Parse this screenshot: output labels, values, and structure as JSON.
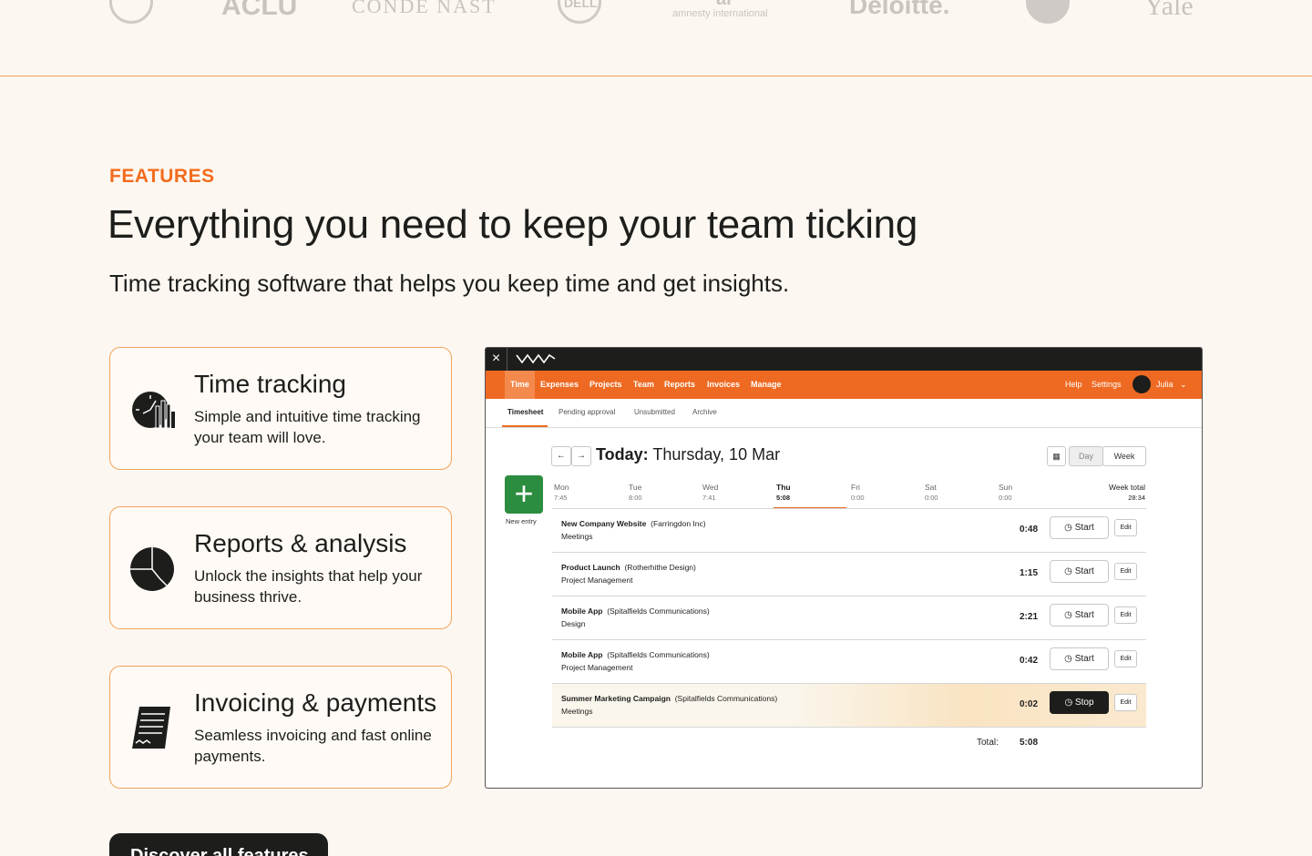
{
  "logos": {
    "aclu": "ACLU",
    "conde": "CONDÉ NAST",
    "dell": "DELL",
    "amnesty_mark": "ai",
    "amnesty": "amnesty international",
    "deloitte": "Deloitte.",
    "yale": "Yale"
  },
  "features": {
    "eyebrow": "FEATURES",
    "title": "Everything you need to keep your team ticking",
    "subtitle": "Time tracking software that helps you keep time and get insights.",
    "cards": [
      {
        "title": "Time tracking",
        "desc": "Simple and intuitive time tracking your team will love.",
        "icon": "clock-chart-icon"
      },
      {
        "title": "Reports & analysis",
        "desc": "Unlock the insights that help your business thrive.",
        "icon": "pie-chart-icon"
      },
      {
        "title": "Invoicing & payments",
        "desc": "Seamless invoicing and fast online payments.",
        "icon": "invoice-icon"
      }
    ],
    "cta": "Discover all features"
  },
  "app": {
    "nav": [
      "Time",
      "Expenses",
      "Projects",
      "Team",
      "Reports",
      "Invoices",
      "Manage"
    ],
    "help": "Help",
    "settings": "Settings",
    "user": "Julia",
    "subtabs": [
      "Timesheet",
      "Pending approval",
      "Unsubmitted",
      "Archive"
    ],
    "date_prefix": "Today:",
    "date": "Thursday, 10 Mar",
    "view_day": "Day",
    "view_week": "Week",
    "new_entry": "New entry",
    "days": [
      {
        "name": "Mon",
        "value": "7:45"
      },
      {
        "name": "Tue",
        "value": "8:00"
      },
      {
        "name": "Wed",
        "value": "7:41"
      },
      {
        "name": "Thu",
        "value": "5:08"
      },
      {
        "name": "Fri",
        "value": "0:00"
      },
      {
        "name": "Sat",
        "value": "0:00"
      },
      {
        "name": "Sun",
        "value": "0:00"
      }
    ],
    "week_total_label": "Week total",
    "week_total": "28:34",
    "entries": [
      {
        "project": "New Company Website",
        "client": "(Farringdon Inc)",
        "task": "Meetings",
        "duration": "0:48",
        "action": "Start",
        "edit": "Edit"
      },
      {
        "project": "Product Launch",
        "client": "(Rotherhithe Design)",
        "task": "Project Management",
        "duration": "1:15",
        "action": "Start",
        "edit": "Edit"
      },
      {
        "project": "Mobile App",
        "client": "(Spitalfields Communications)",
        "task": "Design",
        "duration": "2:21",
        "action": "Start",
        "edit": "Edit"
      },
      {
        "project": "Mobile App",
        "client": "(Spitalfields Communications)",
        "task": "Project Management",
        "duration": "0:42",
        "action": "Start",
        "edit": "Edit"
      },
      {
        "project": "Summer Marketing Campaign",
        "client": "(Spitalfields Communications)",
        "task": "Meetings",
        "duration": "0:02",
        "action": "Stop",
        "edit": "Edit"
      }
    ],
    "total_label": "Total:",
    "total": "5:08"
  },
  "colors": {
    "accent": "#f36c1d",
    "nav": "#ee6a22",
    "dark": "#1d1e1c",
    "green": "#2c8c3f"
  }
}
